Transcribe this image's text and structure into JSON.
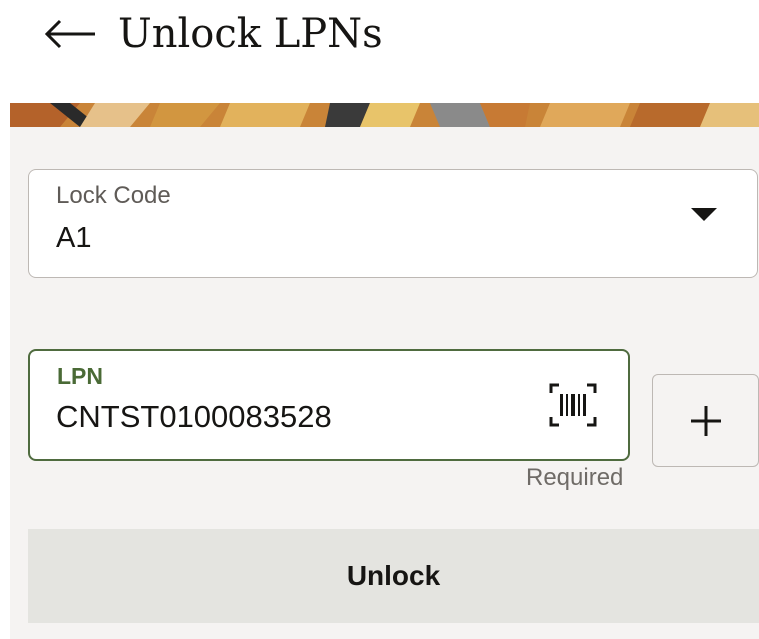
{
  "header": {
    "back_icon": "arrow-left-icon",
    "title": "Unlock LPNs"
  },
  "form": {
    "lock_code": {
      "label": "Lock Code",
      "value": "A1",
      "icon": "chevron-down-icon"
    },
    "lpn": {
      "label": "LPN",
      "value": "CNTST0100083528",
      "scan_icon": "barcode-scan-icon",
      "helper": "Required"
    },
    "add_icon": "plus-icon"
  },
  "actions": {
    "unlock_label": "Unlock"
  },
  "colors": {
    "accent_green": "#4f6b3f",
    "panel_bg": "#f5f3f2",
    "button_bg": "#e4e4e0"
  }
}
